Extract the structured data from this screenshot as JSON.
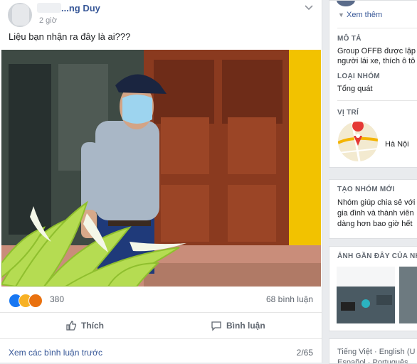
{
  "post": {
    "author": "...ng Duy",
    "timestamp": "2 giờ",
    "text": "Liệu bạn nhận ra đây là ai???",
    "reactions_count": "380",
    "comments_count": "68 bình luận",
    "like_label": "Thích",
    "comment_label": "Bình luận",
    "view_more": "Xem các bình luận trước",
    "comment_pager": "2/65"
  },
  "sidebar": {
    "see_more": "Xem thêm",
    "description_title": "MÔ TẢ",
    "description_line1": "Group OFFB được lập",
    "description_line2": "người lái xe, thích ô tô",
    "group_type_title": "LOẠI NHÓM",
    "group_type": "Tổng quát",
    "location_title": "VỊ TRÍ",
    "location": "Hà Nội",
    "create_group_title": "TẠO NHÓM MỚI",
    "create_line1": "Nhóm giúp chia sẻ với",
    "create_line2": "gia đình và thành viên",
    "create_line3": "dàng hơn bao giờ hết",
    "recent_photos_title": "ẢNH GẦN ĐÂY CỦA NH",
    "lang_line1": "Tiếng Việt · English (U",
    "lang_line2": "Español · Português"
  },
  "colors": {
    "link": "#385898",
    "like_blue": "#1877f2",
    "door": "#8a3a1f",
    "yellow_wall": "#f2c200"
  }
}
